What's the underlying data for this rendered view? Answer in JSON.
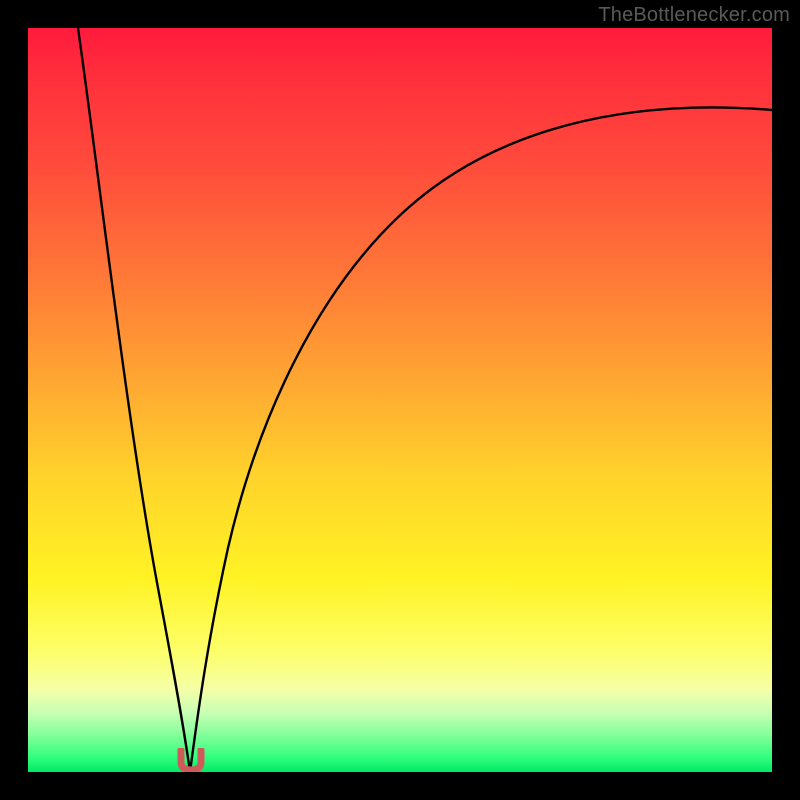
{
  "watermark": "TheBottlenecker.com",
  "chart_data": {
    "type": "line",
    "title": "",
    "xlabel": "",
    "ylabel": "",
    "xlim": [
      0,
      1
    ],
    "ylim": [
      0,
      1
    ],
    "series": [
      {
        "name": "bottleneck-curve-left",
        "x": [
          0.068,
          0.09,
          0.11,
          0.13,
          0.15,
          0.17,
          0.19,
          0.205,
          0.218
        ],
        "y": [
          1.0,
          0.86,
          0.72,
          0.58,
          0.44,
          0.3,
          0.15,
          0.05,
          0.0
        ]
      },
      {
        "name": "bottleneck-curve-right",
        "x": [
          0.218,
          0.23,
          0.245,
          0.27,
          0.3,
          0.34,
          0.39,
          0.45,
          0.52,
          0.6,
          0.69,
          0.79,
          0.9,
          1.0
        ],
        "y": [
          0.0,
          0.08,
          0.18,
          0.3,
          0.41,
          0.51,
          0.6,
          0.68,
          0.74,
          0.79,
          0.83,
          0.86,
          0.88,
          0.89
        ]
      }
    ],
    "marker": {
      "name": "optimal-point",
      "x": 0.218,
      "y": 0.0,
      "color": "#cf5a5a"
    },
    "gradient_stops": [
      {
        "pos": 0.0,
        "color": "#ff1a3c"
      },
      {
        "pos": 0.5,
        "color": "#ffb030"
      },
      {
        "pos": 0.8,
        "color": "#fff324"
      },
      {
        "pos": 1.0,
        "color": "#00e867"
      }
    ]
  }
}
